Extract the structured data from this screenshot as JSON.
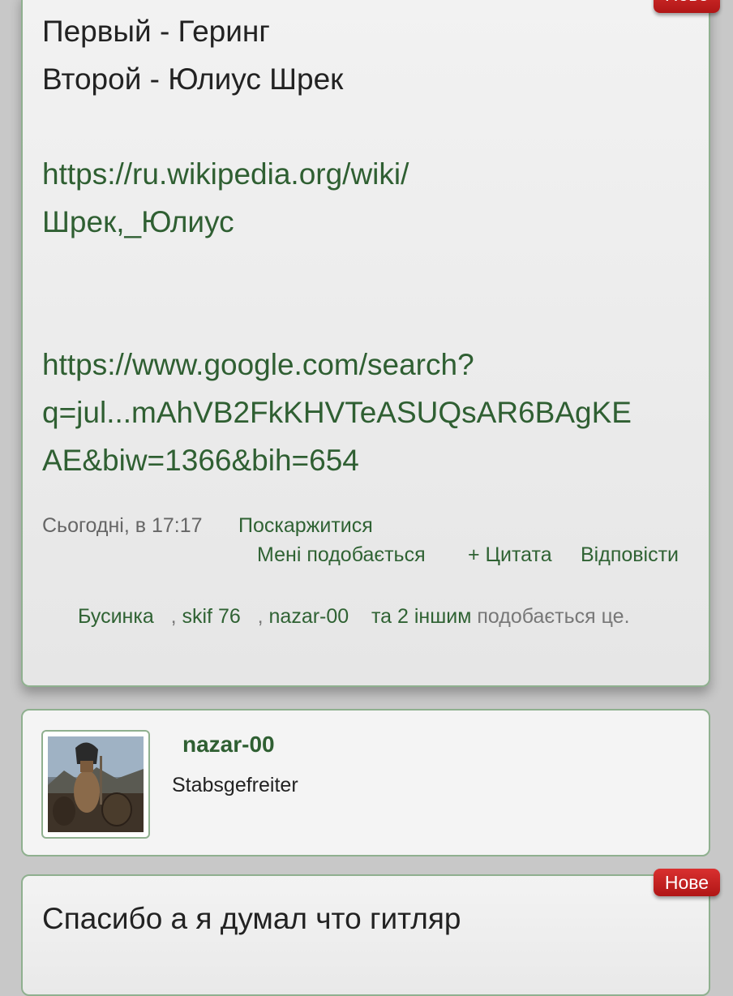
{
  "post1": {
    "badge": "Нове",
    "line1": "Первый - Геринг",
    "line2": "Второй - Юлиус Шрек",
    "link1_a": "https://ru.wikipedia.org/wiki/",
    "link1_b": "Шрек,_Юлиус",
    "link2_a": "https://www.google.com/search?",
    "link2_b": "q=jul...mAhVB2FkKHVTeASUQsAR6BAgKE",
    "link2_c": "AE&biw=1366&bih=654",
    "time": "Сьогодні, в 17:17",
    "report": "Поскаржитися",
    "like": "Мені подобається",
    "quote": "+ Цитата",
    "reply": "Відповісти",
    "likes": {
      "user1": "Бусинка",
      "sep1": ", ",
      "user2": "skif 76",
      "sep2": ", ",
      "user3": "nazar-00",
      "others": "та 2 іншим",
      "suffix": "подобається це."
    }
  },
  "user": {
    "name": "nazar-00",
    "rank": "Stabsgefreiter"
  },
  "post2": {
    "badge": "Нове",
    "text": "Спасибо а я думал что гитляр"
  }
}
